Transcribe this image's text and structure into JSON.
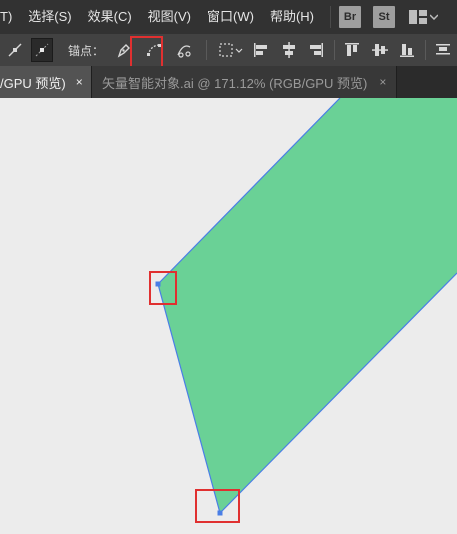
{
  "menu": {
    "items": [
      "T)",
      "选择(S)",
      "效果(C)",
      "视图(V)",
      "窗口(W)",
      "帮助(H)"
    ],
    "bridge_label": "Br",
    "stock_label": "St"
  },
  "control_bar": {
    "anchor_label": "锚点："
  },
  "tabs": [
    {
      "title": "/GPU 预览)",
      "close": "×"
    },
    {
      "title": "矢量智能对象.ai @ 171.12% (RGB/GPU 预览)",
      "close": "×"
    }
  ],
  "colors": {
    "shape_fill": "#6ad196",
    "path_stroke": "#4a7ee6",
    "highlight": "#e03030"
  },
  "icons": [
    "convert-anchor-icon",
    "handle-icon",
    "pen-icon",
    "smooth-anchor-icon",
    "cut-path-icon",
    "select-box-icon",
    "align-left-icon",
    "align-hcenter-icon",
    "align-right-icon",
    "align-top-icon",
    "align-vcenter-icon",
    "align-bottom-icon",
    "distribute-icon"
  ]
}
